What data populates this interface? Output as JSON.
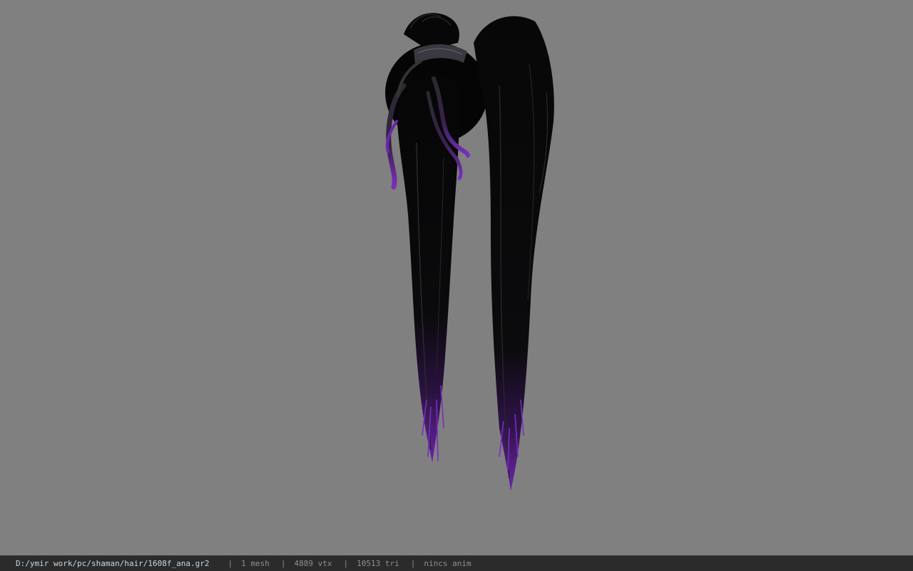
{
  "viewport": {
    "background": "#808080",
    "model": {
      "name": "hair-model",
      "colors": {
        "hair": "#050505",
        "highlight": "#2a2a2a",
        "tips": "#5a1e8c",
        "band": "#3a3840"
      }
    }
  },
  "statusbar": {
    "file_path": "D:/ymir work/pc/shaman/hair/1608f_ana.gr2",
    "separator": "|",
    "mesh_count": "1 mesh",
    "vertex_count": "4889 vtx",
    "triangle_count": "10513 tri",
    "anim_status": "nincs anim"
  }
}
